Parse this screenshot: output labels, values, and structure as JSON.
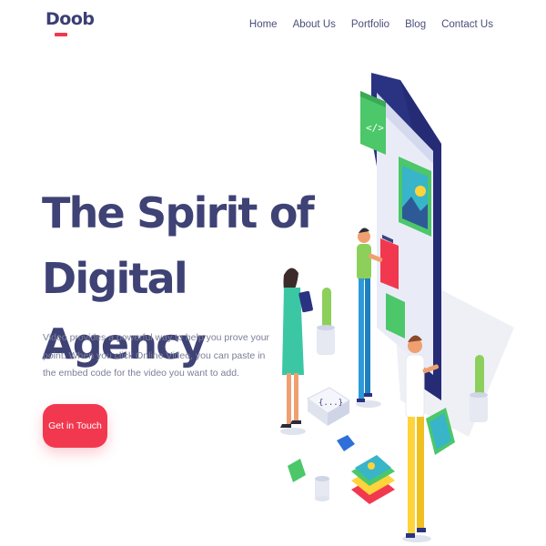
{
  "brand": {
    "name": "Doob",
    "accent": "#f0384e"
  },
  "nav": {
    "items": [
      "Home",
      "About Us",
      "Portfolio",
      "Blog",
      "Contact Us"
    ]
  },
  "hero": {
    "title_line1": "The Spirit of",
    "title_line2": "Digital Agency",
    "description": "Video provides a powerful way to help you prove your point. When you click Online Video, you can paste in the embed code for the video you want to add.",
    "cta_label": "Get in Touch"
  },
  "illustration": {
    "code_badge": "</>",
    "braces_label": "{...}"
  },
  "colors": {
    "heading": "#3f4275",
    "primary": "#2f3a8f",
    "green": "#4cc76a",
    "button": "#f2384f"
  }
}
